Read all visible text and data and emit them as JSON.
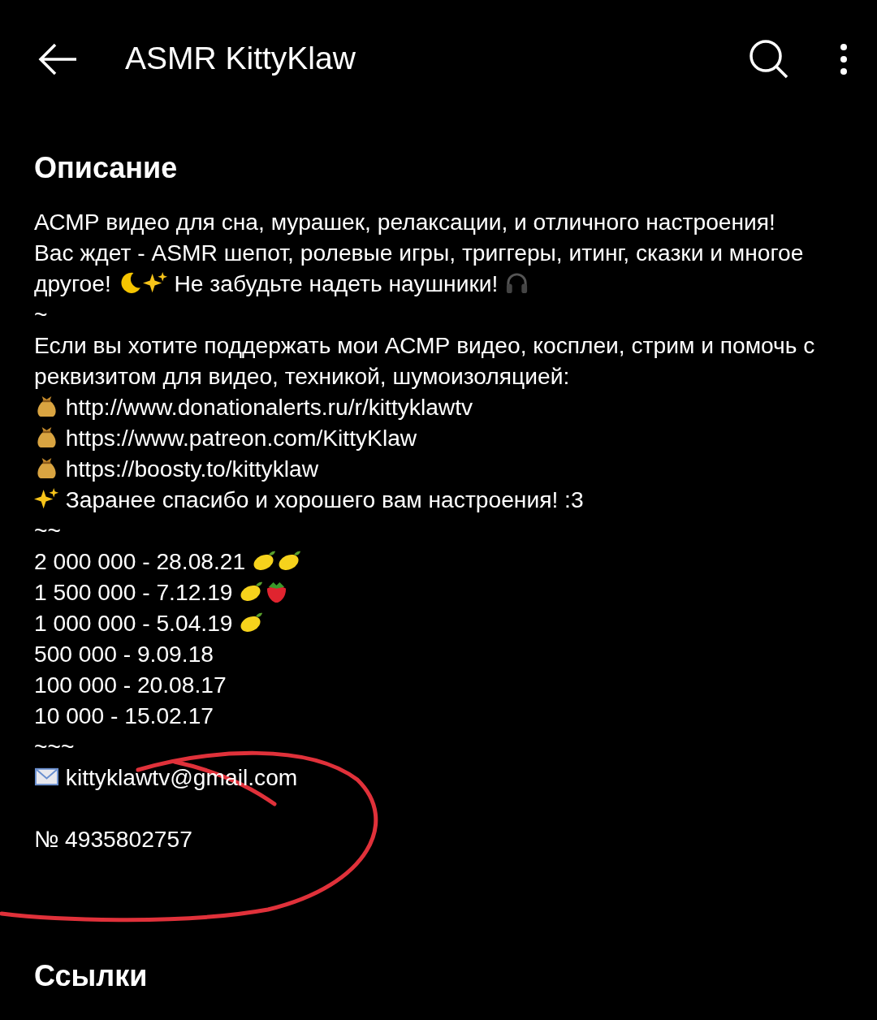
{
  "app_bar": {
    "title": "ASMR KittyKlaw"
  },
  "description": {
    "heading": "Описание",
    "lines": [
      {
        "kind": "text",
        "parts": [
          {
            "kind": "text",
            "text": "АСМР видео для сна, мурашек, релаксации, и отличного настроения!"
          }
        ]
      },
      {
        "kind": "text",
        "parts": [
          {
            "kind": "text",
            "text": "Вас ждет - ASMR шепот, ролевые игры, триггеры, итинг, сказки и многое"
          }
        ]
      },
      {
        "kind": "text",
        "parts": [
          {
            "kind": "text",
            "text": "другое! "
          },
          {
            "kind": "moon"
          },
          {
            "kind": "sparkles"
          },
          {
            "kind": "text",
            "text": " Не забудьте надеть наушники! "
          },
          {
            "kind": "headphones"
          }
        ]
      },
      {
        "kind": "text",
        "parts": [
          {
            "kind": "text",
            "text": "~"
          }
        ]
      },
      {
        "kind": "text",
        "parts": [
          {
            "kind": "text",
            "text": "Если вы хотите поддержать мои АСМР видео, косплеи, стрим и помочь с реквизитом для видео, техникой, шумоизоляцией:"
          }
        ]
      },
      {
        "kind": "text",
        "parts": [
          {
            "kind": "moneybag"
          },
          {
            "kind": "text",
            "text": " http://www.donationalerts.ru/r/kittyklawtv"
          }
        ]
      },
      {
        "kind": "text",
        "parts": [
          {
            "kind": "moneybag"
          },
          {
            "kind": "text",
            "text": " https://www.patreon.com/KittyKlaw"
          }
        ]
      },
      {
        "kind": "text",
        "parts": [
          {
            "kind": "moneybag"
          },
          {
            "kind": "text",
            "text": " https://boosty.to/kittyklaw"
          }
        ]
      },
      {
        "kind": "text",
        "parts": [
          {
            "kind": "sparkles"
          },
          {
            "kind": "text",
            "text": " Заранее спасибо и хорошего вам настроения! :3"
          }
        ]
      },
      {
        "kind": "text",
        "parts": [
          {
            "kind": "text",
            "text": "~~"
          }
        ]
      },
      {
        "kind": "text",
        "parts": [
          {
            "kind": "text",
            "text": "2 000 000 - 28.08.21 "
          },
          {
            "kind": "lemon"
          },
          {
            "kind": "lemon"
          }
        ]
      },
      {
        "kind": "text",
        "parts": [
          {
            "kind": "text",
            "text": "1 500 000 - 7.12.19 "
          },
          {
            "kind": "lemon"
          },
          {
            "kind": "strawberry"
          }
        ]
      },
      {
        "kind": "text",
        "parts": [
          {
            "kind": "text",
            "text": "1 000 000 - 5.04.19 "
          },
          {
            "kind": "lemon"
          }
        ]
      },
      {
        "kind": "text",
        "parts": [
          {
            "kind": "text",
            "text": "500 000 - 9.09.18"
          }
        ]
      },
      {
        "kind": "text",
        "parts": [
          {
            "kind": "text",
            "text": "100 000 - 20.08.17"
          }
        ]
      },
      {
        "kind": "text",
        "parts": [
          {
            "kind": "text",
            "text": "10 000 - 15.02.17"
          }
        ]
      },
      {
        "kind": "text",
        "parts": [
          {
            "kind": "text",
            "text": "~~~"
          }
        ]
      },
      {
        "kind": "text",
        "parts": [
          {
            "kind": "envelope"
          },
          {
            "kind": "text",
            "text": " kittyklawtv@gmail.com"
          }
        ]
      },
      {
        "kind": "blank"
      },
      {
        "kind": "text",
        "parts": [
          {
            "kind": "text",
            "text": "№ 4935802757"
          }
        ]
      }
    ]
  },
  "links": {
    "heading": "Ссылки"
  }
}
